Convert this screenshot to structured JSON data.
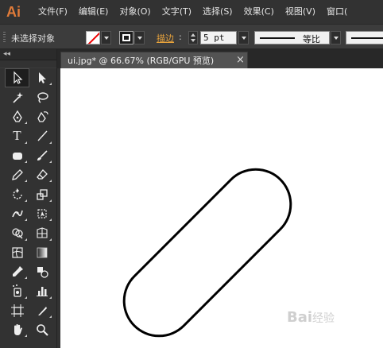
{
  "app": {
    "logo": "Ai",
    "menu": [
      "文件(F)",
      "编辑(E)",
      "对象(O)",
      "文字(T)",
      "选择(S)",
      "效果(C)",
      "视图(V)",
      "窗口("
    ]
  },
  "control_bar": {
    "selection_label": "未选择对象",
    "stroke_label": "描边",
    "stroke_colon": ":",
    "stroke_weight": "5 pt",
    "profile_label": "等比"
  },
  "document": {
    "tab_title": "ui.jpg* @ 66.67% (RGB/GPU 预览)",
    "close_glyph": "×"
  },
  "tools_panel": {
    "collapse_glyph": "◂◂",
    "type_tool_glyph": "T"
  },
  "canvas": {
    "watermark": "Bai",
    "watermark_sub": "经验"
  },
  "colors": {
    "accent": "#e07b39",
    "stroke_label": "#e8a33c",
    "ui_dark": "#323232",
    "canvas": "#ffffff"
  }
}
